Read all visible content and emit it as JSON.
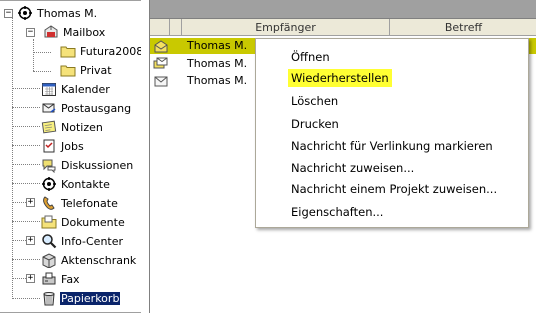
{
  "tree": {
    "root": {
      "label": "Thomas M.",
      "icon": "user-settings-icon",
      "expander": "−"
    },
    "items": [
      {
        "label": "Mailbox",
        "icon": "mailbox-icon",
        "expander": "−"
      },
      {
        "label": "Futura2008",
        "icon": "folder-icon"
      },
      {
        "label": "Privat",
        "icon": "folder-icon"
      },
      {
        "label": "Kalender",
        "icon": "calendar-icon"
      },
      {
        "label": "Postausgang",
        "icon": "outbox-icon"
      },
      {
        "label": "Notizen",
        "icon": "notes-icon"
      },
      {
        "label": "Jobs",
        "icon": "jobs-icon"
      },
      {
        "label": "Diskussionen",
        "icon": "discussions-icon"
      },
      {
        "label": "Kontakte",
        "icon": "contacts-icon"
      },
      {
        "label": "Telefonate",
        "icon": "phone-icon",
        "expander": "+"
      },
      {
        "label": "Dokumente",
        "icon": "documents-icon"
      },
      {
        "label": "Info-Center",
        "icon": "magnifier-icon",
        "expander": "+"
      },
      {
        "label": "Aktenschrank",
        "icon": "file-cabinet-icon"
      },
      {
        "label": "Fax",
        "icon": "fax-icon",
        "expander": "+"
      },
      {
        "label": "Papierkorb",
        "icon": "trash-icon",
        "selected": true
      }
    ]
  },
  "list": {
    "columns": [
      {
        "label": ""
      },
      {
        "label": "Empfänger"
      },
      {
        "label": "Betreff"
      }
    ],
    "rows": [
      {
        "sender": "Thomas M.",
        "icon": "mail-open-icon",
        "highlighted": true
      },
      {
        "sender": "Thomas M.",
        "icon": "mail-stack-icon"
      },
      {
        "sender": "Thomas M.",
        "icon": "envelope-icon"
      }
    ]
  },
  "context_menu": {
    "items": [
      {
        "label": "Öffnen"
      },
      {
        "label": "Wiederherstellen",
        "highlighted": true
      },
      {
        "label": "Löschen"
      },
      {
        "label": "Drucken"
      },
      {
        "label": "Nachricht für Verlinkung markieren"
      },
      {
        "label": "Nachricht zuweisen..."
      },
      {
        "label": "Nachricht einem Projekt zuweisen..."
      },
      {
        "label": "Eigenschaften..."
      }
    ]
  },
  "colors": {
    "selection": "#0a246a",
    "row_highlight": "#c9c900",
    "menu_highlight": "#ffff33"
  }
}
